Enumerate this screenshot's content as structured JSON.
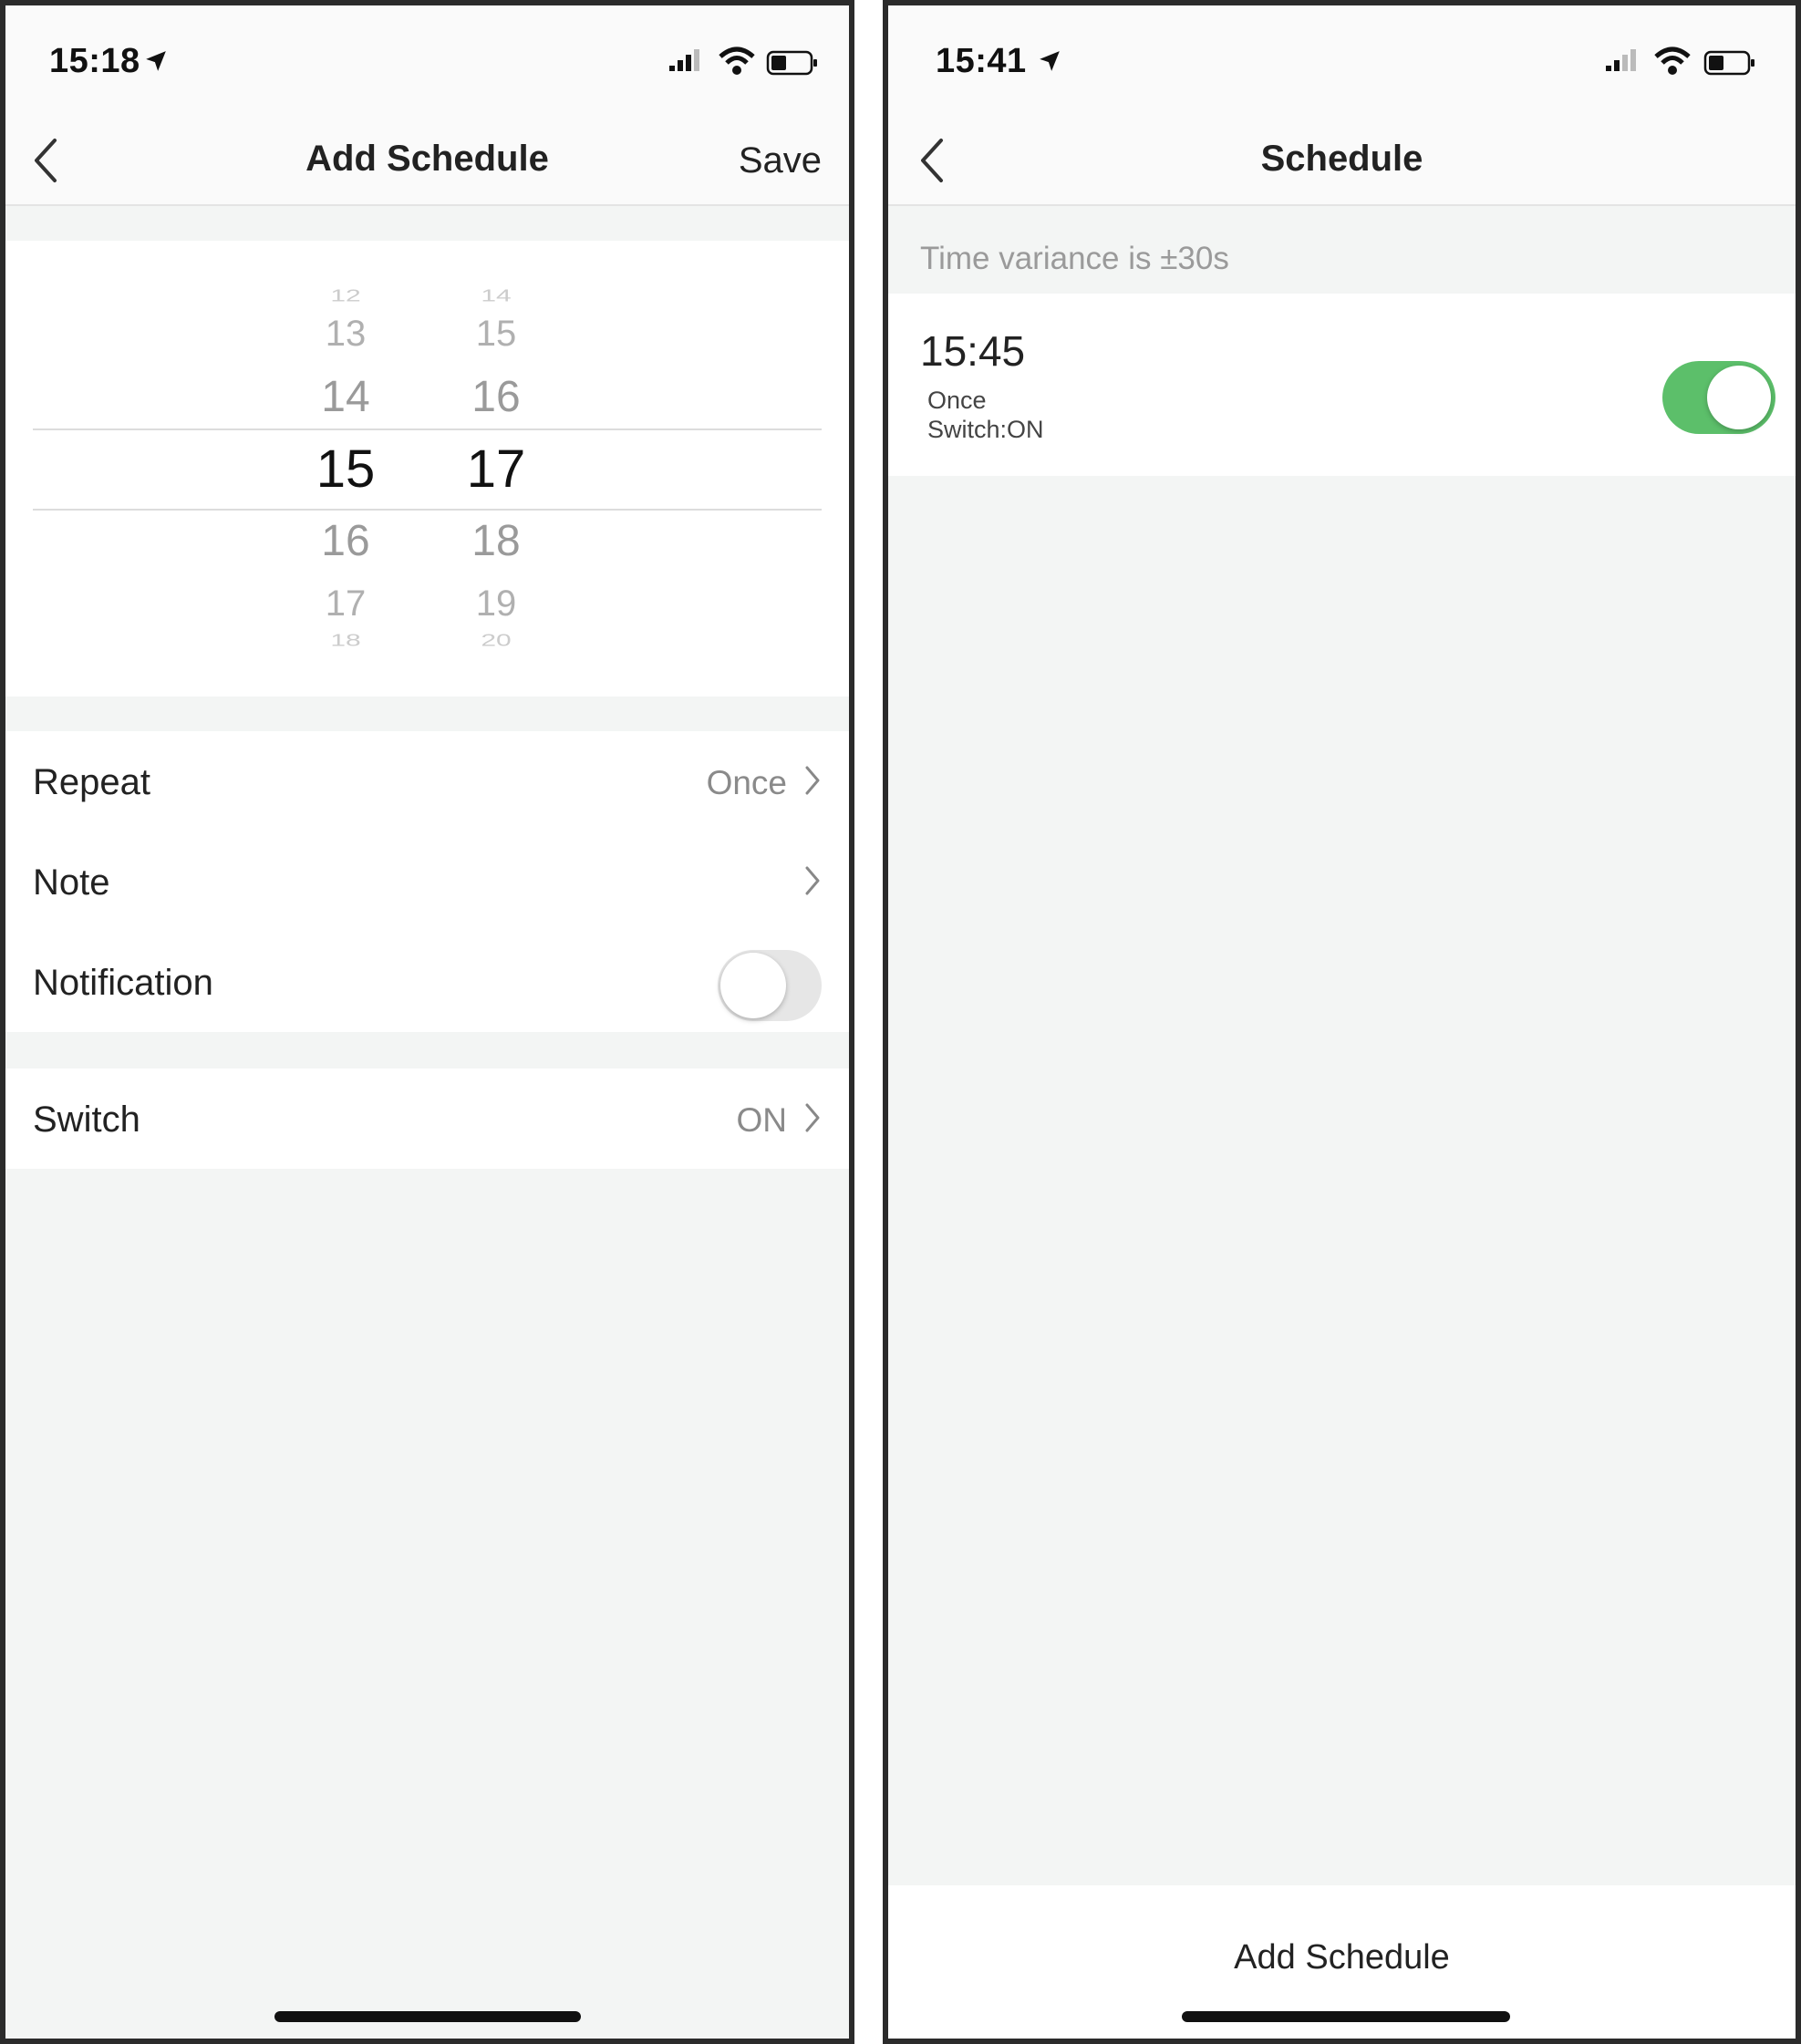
{
  "left_screen": {
    "status_time": "15:18",
    "title": "Add Schedule",
    "save_label": "Save",
    "picker": {
      "hours": [
        "12",
        "13",
        "14",
        "15",
        "16",
        "17",
        "18"
      ],
      "minutes": [
        "14",
        "15",
        "16",
        "17",
        "18",
        "19",
        "20"
      ],
      "selected_hour": "15",
      "selected_minute": "17"
    },
    "rows": {
      "repeat_label": "Repeat",
      "repeat_value": "Once",
      "note_label": "Note",
      "notification_label": "Notification",
      "notification_on": false,
      "switch_label": "Switch",
      "switch_value": "ON"
    }
  },
  "right_screen": {
    "status_time": "15:41",
    "title": "Schedule",
    "variance_text": "Time variance is  ±30s",
    "schedule": {
      "time": "15:45",
      "repeat": "Once",
      "action": "Switch:ON",
      "enabled": true
    },
    "add_schedule_label": "Add Schedule"
  },
  "colors": {
    "toggle_on": "#5cbf6a",
    "toggle_off": "#e6e6e6",
    "background": "#f3f5f4"
  },
  "icons": [
    "location-arrow-icon",
    "signal-icon",
    "wifi-icon",
    "battery-icon",
    "back-chevron-icon",
    "chevron-right-icon"
  ]
}
